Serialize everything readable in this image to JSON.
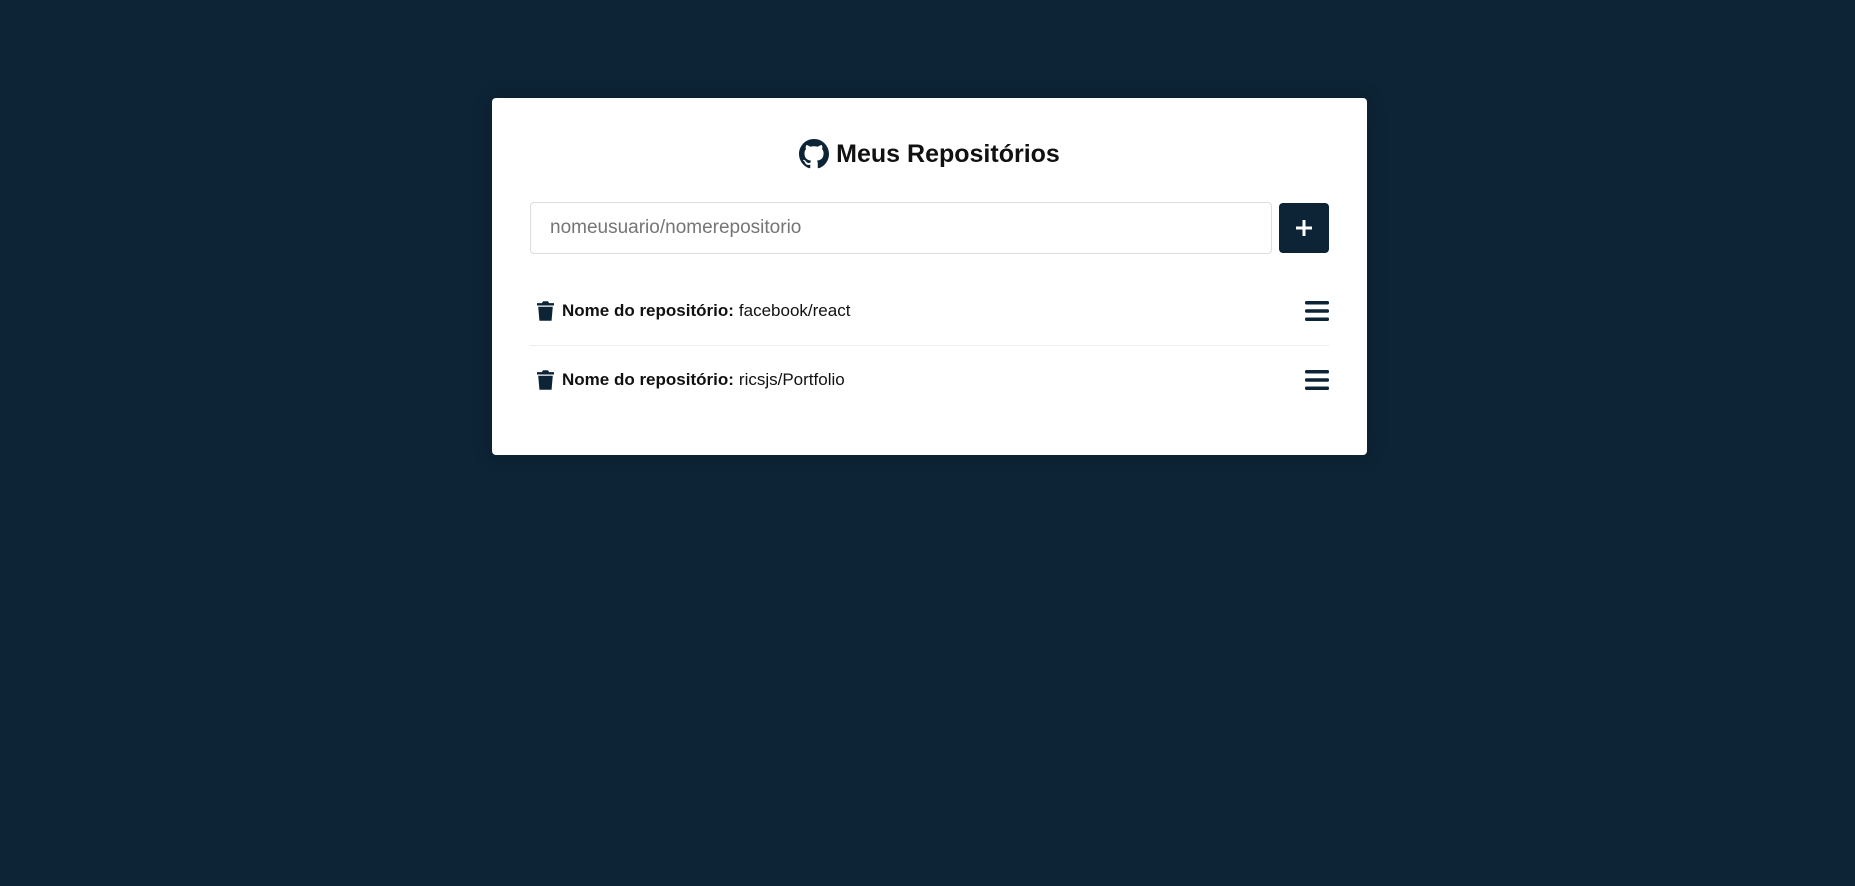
{
  "header": {
    "title": "Meus Repositórios"
  },
  "form": {
    "input_value": "",
    "input_placeholder": "nomeusuario/nomerepositorio",
    "add_button_icon": "plus-icon"
  },
  "repositories": [
    {
      "label": "Nome do repositório:",
      "name": "facebook/react"
    },
    {
      "label": "Nome do repositório:",
      "name": "ricsjs/Portfolio"
    }
  ],
  "colors": {
    "background": "#0d2436",
    "card": "#ffffff",
    "accent": "#0d2436"
  }
}
